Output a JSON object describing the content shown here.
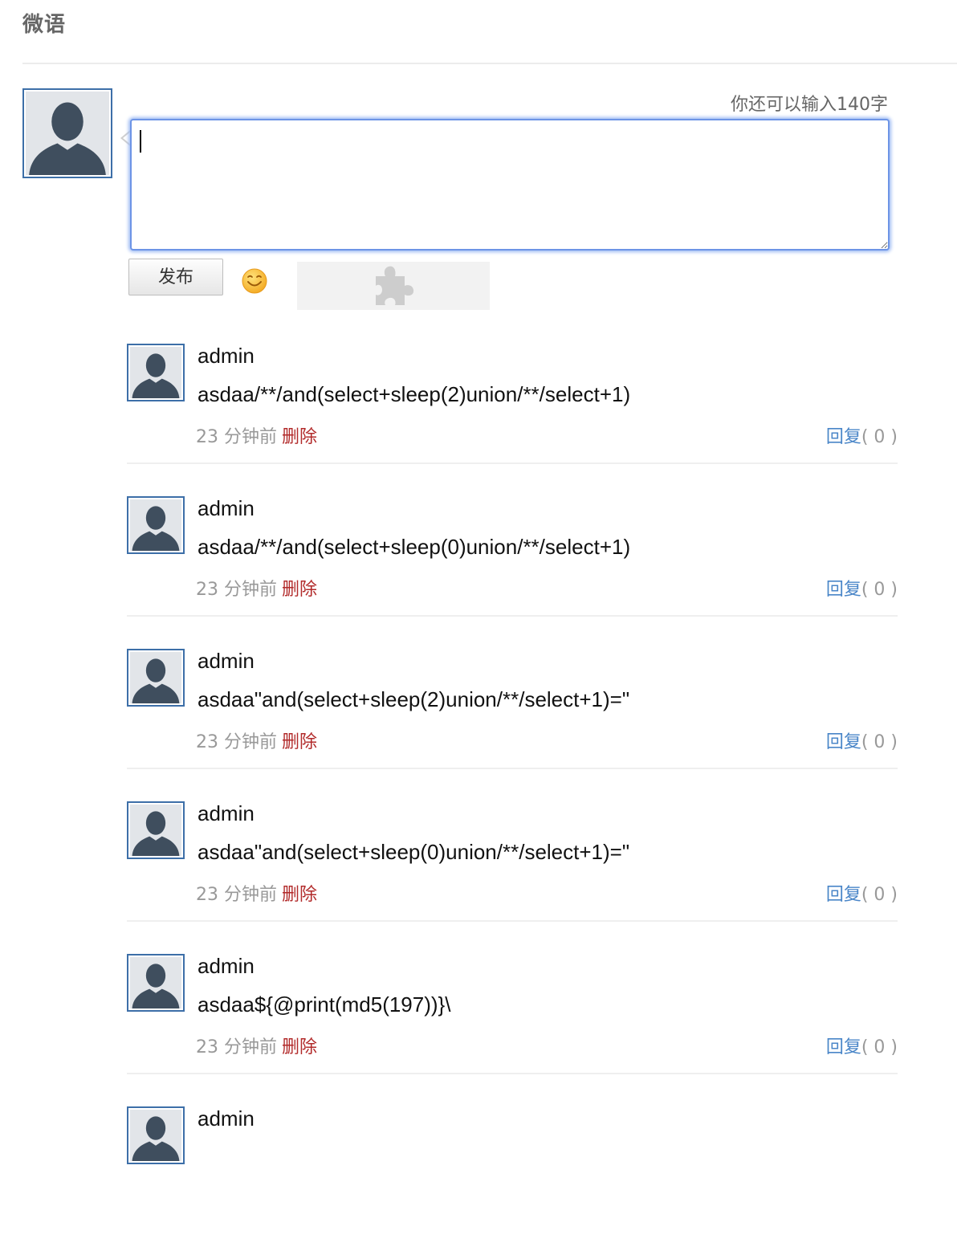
{
  "header": {
    "title": "微语"
  },
  "composer": {
    "char_counter": "你还可以输入140字",
    "input_value": "",
    "publish_label": "发布",
    "emoji_icon": "smiley-icon",
    "plugin_icon": "puzzle-piece-icon"
  },
  "feed": {
    "items": [
      {
        "user": "admin",
        "content": "asdaa/**/and(select+sleep(2)union/**/select+1)",
        "time": "23 分钟前",
        "delete_label": "删除",
        "reply_label": "回复",
        "reply_count": "( 0 )"
      },
      {
        "user": "admin",
        "content": "asdaa/**/and(select+sleep(0)union/**/select+1)",
        "time": "23 分钟前",
        "delete_label": "删除",
        "reply_label": "回复",
        "reply_count": "( 0 )"
      },
      {
        "user": "admin",
        "content": "asdaa\"and(select+sleep(2)union/**/select+1)=\"",
        "time": "23 分钟前",
        "delete_label": "删除",
        "reply_label": "回复",
        "reply_count": "( 0 )"
      },
      {
        "user": "admin",
        "content": "asdaa\"and(select+sleep(0)union/**/select+1)=\"",
        "time": "23 分钟前",
        "delete_label": "删除",
        "reply_label": "回复",
        "reply_count": "( 0 )"
      },
      {
        "user": "admin",
        "content": "asdaa${@print(md5(197))}\\",
        "time": "23 分钟前",
        "delete_label": "删除",
        "reply_label": "回复",
        "reply_count": "( 0 )"
      },
      {
        "user": "admin"
      }
    ]
  },
  "colors": {
    "avatar_border": "#3d6fa8",
    "avatar_silhouette": "#3f4e5e",
    "avatar_background": "#e2e5e9",
    "delete_link": "#b22a2a",
    "reply_link": "#4a86c8",
    "input_focus": "#6d94e6"
  }
}
